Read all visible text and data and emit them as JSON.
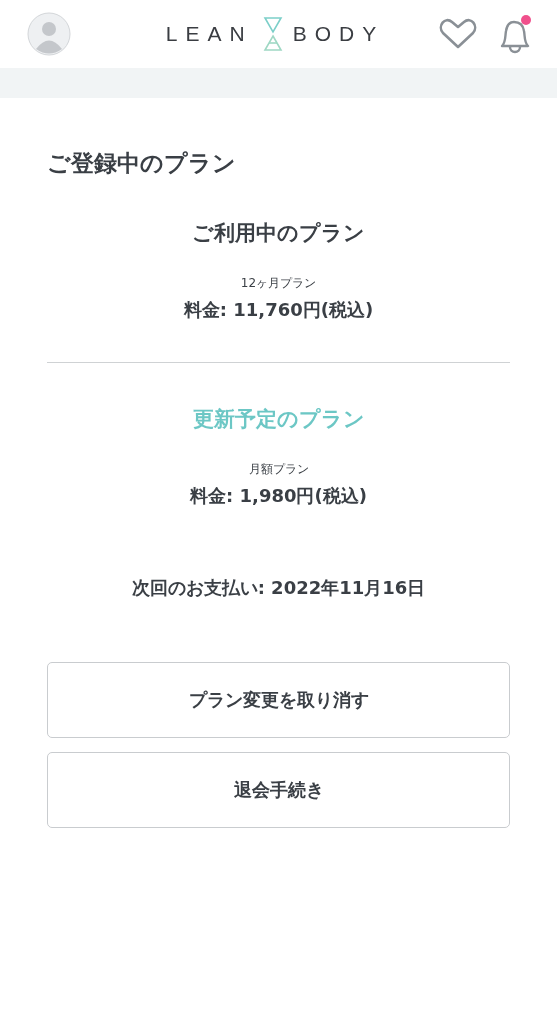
{
  "header": {
    "logo_left": "LEAN",
    "logo_right": "BODY",
    "notification_badge": true
  },
  "page_title": "ご登録中のプラン",
  "plans": [
    {
      "heading": "ご利用中のプラン",
      "highlighted": false,
      "plan_name": "12ヶ月プラン",
      "price": "料金: 11,760円(税込)"
    },
    {
      "heading": "更新予定のプラン",
      "highlighted": true,
      "plan_name": "月額プラン",
      "price": "料金: 1,980円(税込)"
    }
  ],
  "next_payment": "次回のお支払い: 2022年11月16日",
  "buttons": [
    "プラン変更を取り消す",
    "退会手続き"
  ]
}
